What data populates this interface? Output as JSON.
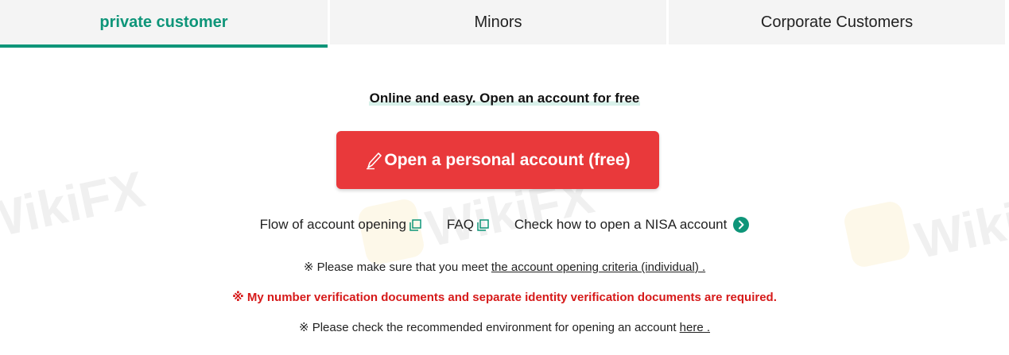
{
  "tabs": [
    {
      "label": "private customer",
      "active": true
    },
    {
      "label": "Minors",
      "active": false
    },
    {
      "label": "Corporate Customers",
      "active": false
    }
  ],
  "headline": "Online and easy. Open an account for free",
  "cta": {
    "label": "Open a personal account (free)",
    "icon": "pencil-icon",
    "color": "#e9393b"
  },
  "links": {
    "flow": "Flow of account opening",
    "faq": "FAQ",
    "nisa": "Check how to open a NISA account"
  },
  "notes": {
    "criteria_prefix": "※ Please make sure that you meet ",
    "criteria_link": "the account opening criteria (individual) .",
    "documents": "※ My number verification documents and separate identity verification documents are required.",
    "env_prefix": "※ Please check the recommended environment for opening an account ",
    "env_link": "here ."
  },
  "watermark": "WikiFX",
  "colors": {
    "accent": "#0e9579",
    "alert": "#d61a1a"
  }
}
